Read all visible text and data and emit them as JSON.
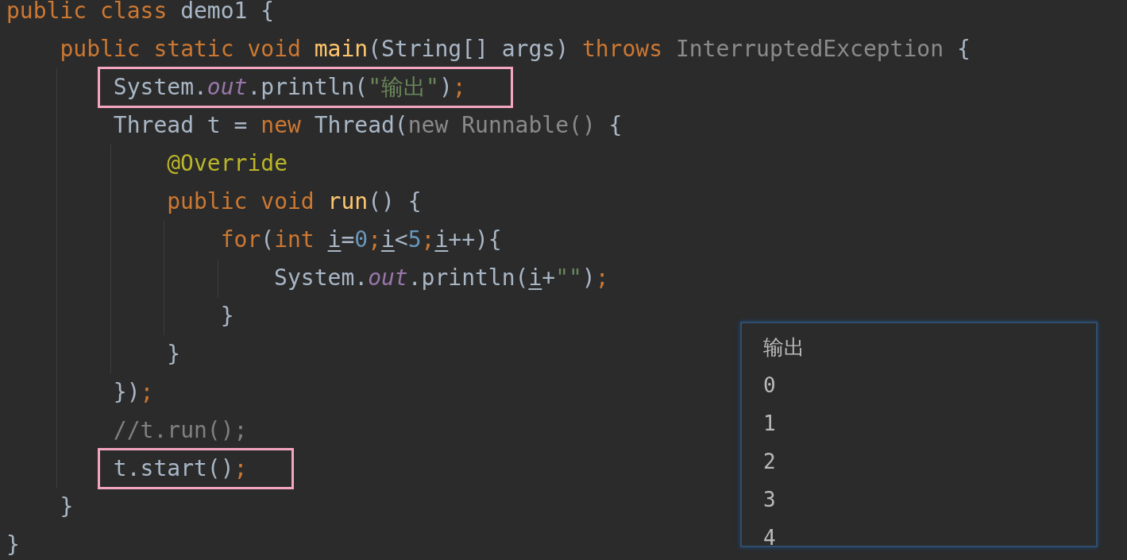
{
  "editor": {
    "lines": [
      {
        "highlighted": false,
        "tokens": [
          {
            "kind": "keyword",
            "text": "public class "
          },
          {
            "kind": "plain",
            "text": "demo1 {"
          }
        ],
        "children": [
          {
            "highlighted": false,
            "tokens": [
              {
                "kind": "keyword",
                "text": "public static void "
              },
              {
                "kind": "method",
                "text": "main"
              },
              {
                "kind": "plain",
                "text": "(String[] args) "
              },
              {
                "kind": "keyword",
                "text": "throws "
              },
              {
                "kind": "muted",
                "text": "InterruptedException"
              },
              {
                "kind": "plain",
                "text": " {"
              }
            ],
            "children": [
              {
                "highlighted": true,
                "tokens": [
                  {
                    "kind": "plain",
                    "text": "System."
                  },
                  {
                    "kind": "field",
                    "text": "out"
                  },
                  {
                    "kind": "plain",
                    "text": ".println("
                  },
                  {
                    "kind": "string",
                    "text": "\"输出\""
                  },
                  {
                    "kind": "plain",
                    "text": ")"
                  },
                  {
                    "kind": "keyword",
                    "text": ";"
                  }
                ]
              },
              {
                "highlighted": false,
                "tokens": [
                  {
                    "kind": "plain",
                    "text": "Thread t = "
                  },
                  {
                    "kind": "keyword",
                    "text": "new "
                  },
                  {
                    "kind": "plain",
                    "text": "Thread("
                  },
                  {
                    "kind": "muted",
                    "text": "new Runnable()"
                  },
                  {
                    "kind": "plain",
                    "text": " {"
                  }
                ],
                "children": [
                  {
                    "highlighted": false,
                    "tokens": [
                      {
                        "kind": "annotation",
                        "text": "@Override"
                      }
                    ]
                  },
                  {
                    "highlighted": false,
                    "tokens": [
                      {
                        "kind": "keyword",
                        "text": "public void "
                      },
                      {
                        "kind": "method",
                        "text": "run"
                      },
                      {
                        "kind": "plain",
                        "text": "() {"
                      }
                    ],
                    "children": [
                      {
                        "highlighted": false,
                        "tokens": [
                          {
                            "kind": "keyword",
                            "text": "for"
                          },
                          {
                            "kind": "plain",
                            "text": "("
                          },
                          {
                            "kind": "keyword",
                            "text": "int "
                          },
                          {
                            "kind": "local",
                            "text": "i"
                          },
                          {
                            "kind": "plain",
                            "text": "="
                          },
                          {
                            "kind": "number",
                            "text": "0"
                          },
                          {
                            "kind": "keyword",
                            "text": ";"
                          },
                          {
                            "kind": "local",
                            "text": "i"
                          },
                          {
                            "kind": "plain",
                            "text": "<"
                          },
                          {
                            "kind": "number",
                            "text": "5"
                          },
                          {
                            "kind": "keyword",
                            "text": ";"
                          },
                          {
                            "kind": "local",
                            "text": "i"
                          },
                          {
                            "kind": "plain",
                            "text": "++){"
                          }
                        ],
                        "children": [
                          {
                            "highlighted": false,
                            "tokens": [
                              {
                                "kind": "plain",
                                "text": "System."
                              },
                              {
                                "kind": "field",
                                "text": "out"
                              },
                              {
                                "kind": "plain",
                                "text": ".println("
                              },
                              {
                                "kind": "local",
                                "text": "i"
                              },
                              {
                                "kind": "plain",
                                "text": "+"
                              },
                              {
                                "kind": "string",
                                "text": "\"\""
                              },
                              {
                                "kind": "plain",
                                "text": ")"
                              },
                              {
                                "kind": "keyword",
                                "text": ";"
                              }
                            ]
                          }
                        ]
                      },
                      {
                        "highlighted": false,
                        "tokens": [
                          {
                            "kind": "plain",
                            "text": "}"
                          }
                        ]
                      }
                    ]
                  },
                  {
                    "highlighted": false,
                    "tokens": [
                      {
                        "kind": "plain",
                        "text": "}"
                      }
                    ]
                  }
                ]
              },
              {
                "highlighted": false,
                "tokens": [
                  {
                    "kind": "plain",
                    "text": "})"
                  },
                  {
                    "kind": "keyword",
                    "text": ";"
                  }
                ]
              },
              {
                "highlighted": false,
                "tokens": [
                  {
                    "kind": "comment",
                    "text": "//t.run();"
                  }
                ]
              },
              {
                "highlighted": true,
                "tokens": [
                  {
                    "kind": "plain",
                    "text": "t.start()"
                  },
                  {
                    "kind": "keyword",
                    "text": ";"
                  }
                ]
              }
            ]
          },
          {
            "highlighted": false,
            "tokens": [
              {
                "kind": "plain",
                "text": "}"
              }
            ]
          }
        ]
      },
      {
        "highlighted": false,
        "tokens": [
          {
            "kind": "plain",
            "text": "}"
          }
        ]
      }
    ]
  },
  "output": {
    "lines": [
      "输出",
      "0",
      "1",
      "2",
      "3",
      "4"
    ]
  }
}
